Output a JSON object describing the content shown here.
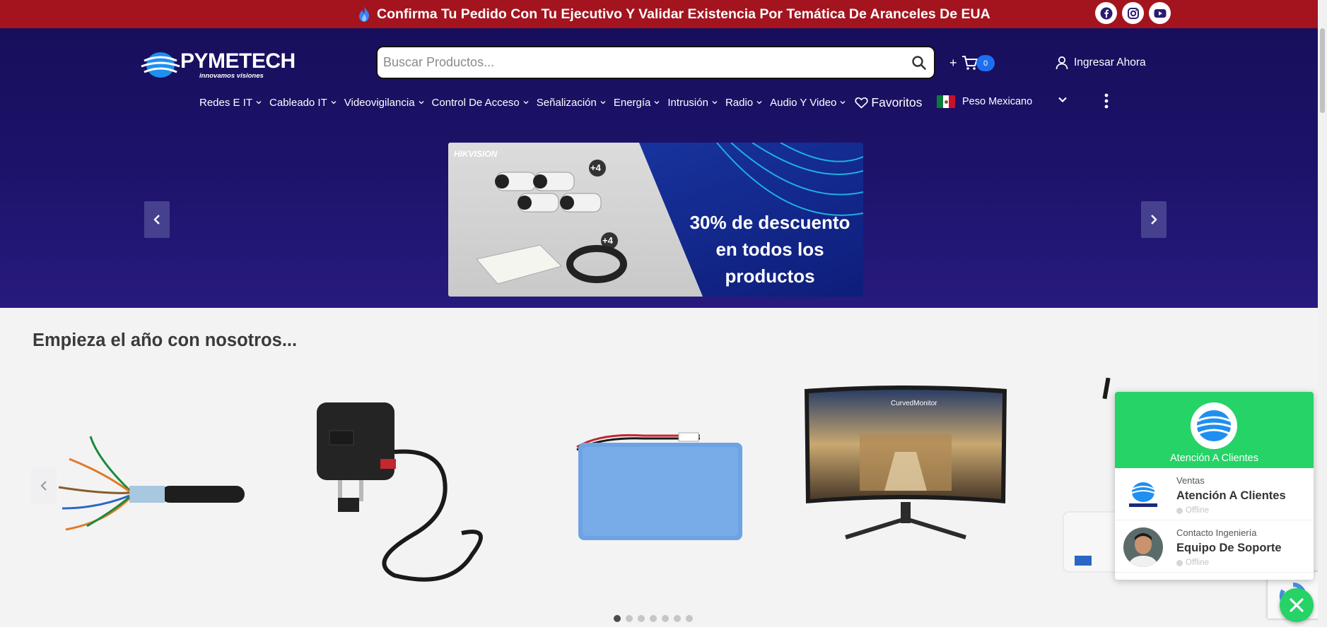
{
  "topbar": {
    "message": "Confirma Tu Pedido Con Tu Ejecutivo Y Validar Existencia Por Temática De Aranceles De EUA",
    "social_icons": [
      "facebook-icon",
      "instagram-icon",
      "youtube-icon"
    ],
    "background": "#a3141f"
  },
  "header": {
    "logo_text": "PYMETECH",
    "logo_tagline": "innovamos visiones",
    "search": {
      "placeholder": "Buscar Productos..."
    },
    "cart": {
      "plus": "+",
      "count": "0"
    },
    "login_label": "Ingresar Ahora",
    "nav": [
      {
        "label": "Redes E IT"
      },
      {
        "label": "Cableado IT"
      },
      {
        "label": "Videovigilancia"
      },
      {
        "label": "Control De Acceso"
      },
      {
        "label": "Señalización"
      },
      {
        "label": "Energía"
      },
      {
        "label": "Intrusión"
      },
      {
        "label": "Radio"
      },
      {
        "label": "Audio Y Video"
      }
    ],
    "favorites_label": "Favoritos",
    "currency_label": "Peso Mexicano"
  },
  "banner": {
    "brand": "HIKVISION",
    "badge_top": "+4",
    "badge_bottom": "+4",
    "line1": "30% de descuento",
    "line2": "en todos los",
    "line3": "productos"
  },
  "section": {
    "title": "Empieza el año con nosotros...",
    "products": [
      {
        "name": "cable-utp-product"
      },
      {
        "name": "power-adapter-product"
      },
      {
        "name": "battery-product"
      },
      {
        "name": "curved-monitor-product",
        "label": "CurvedMonitor"
      },
      {
        "name": "router-product"
      }
    ],
    "pagination_count": 7,
    "pagination_active": 1
  },
  "chat": {
    "title": "Atención A Clientes",
    "agents": [
      {
        "role": "Ventas",
        "name": "Atención A Clientes",
        "status": "Offline"
      },
      {
        "role": "Contacto Ingeniería",
        "name": "Equipo De Soporte",
        "status": "Offline"
      }
    ],
    "accent": "#25d366"
  }
}
